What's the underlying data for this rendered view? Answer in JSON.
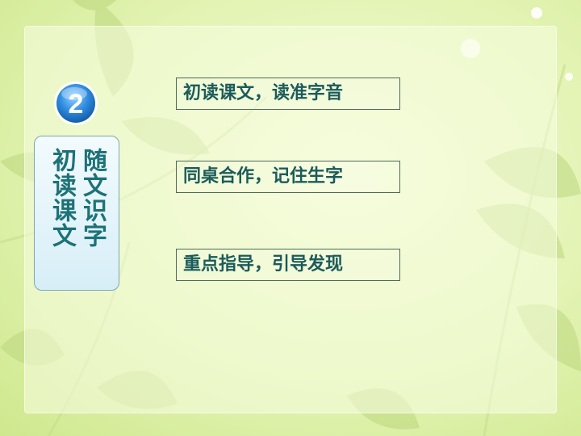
{
  "badge": {
    "number": "2"
  },
  "side_label": {
    "line1": "随文识字",
    "line2": "初读课文"
  },
  "items": [
    {
      "text": "初读课文，读准字音"
    },
    {
      "text": "同桌合作，记住生字"
    },
    {
      "text": "重点指导，引导发现"
    }
  ],
  "colors": {
    "accent": "#1b5b5b",
    "badge_blue": "#1f6fc0",
    "side_text": "#1c7277"
  }
}
